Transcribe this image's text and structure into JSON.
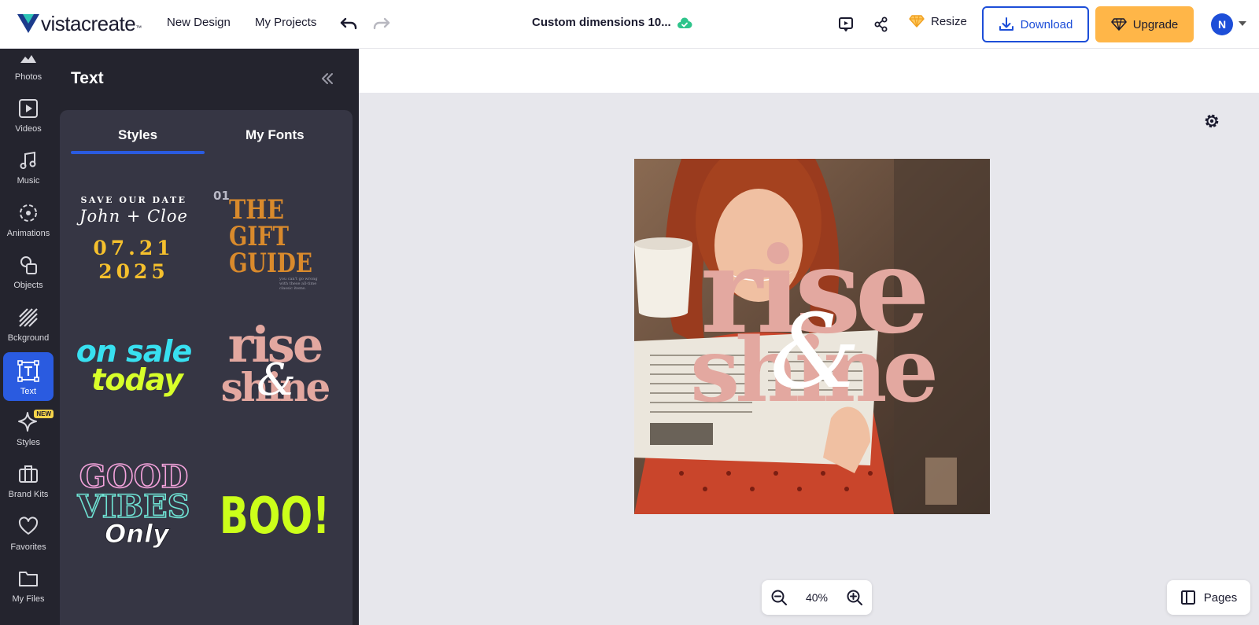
{
  "header": {
    "logo_text_a": "vista",
    "logo_text_b": "create",
    "logo_tm": "™",
    "new_design": "New Design",
    "my_projects": "My Projects",
    "doc_title": "Custom dimensions 10...",
    "resize": "Resize",
    "download": "Download",
    "upgrade": "Upgrade",
    "avatar_initial": "N"
  },
  "rail": {
    "items": [
      {
        "label": "Photos",
        "icon": "photos-icon"
      },
      {
        "label": "Videos",
        "icon": "video-icon"
      },
      {
        "label": "Music",
        "icon": "music-icon"
      },
      {
        "label": "Animations",
        "icon": "animation-icon"
      },
      {
        "label": "Objects",
        "icon": "objects-icon"
      },
      {
        "label": "Bckground",
        "icon": "background-icon"
      },
      {
        "label": "Text",
        "icon": "text-icon"
      },
      {
        "label": "Styles",
        "icon": "styles-icon"
      },
      {
        "label": "Brand Kits",
        "icon": "briefcase-icon"
      },
      {
        "label": "Favorites",
        "icon": "heart-icon"
      },
      {
        "label": "My Files",
        "icon": "folder-icon"
      }
    ],
    "new_badge": "NEW"
  },
  "panel": {
    "title": "Text",
    "tabs": [
      "Styles",
      "My Fonts"
    ],
    "tiles": {
      "t1": {
        "line1": "SAVE OUR DATE",
        "line2": "John + Cloe",
        "line3": "07.21",
        "line4": "2025"
      },
      "t2": {
        "num": "01",
        "line1": "THE",
        "line2": "GIFT",
        "line3": "GUIDE",
        "small1": "you can't go wrong",
        "small2": "with these all-time",
        "small3": "classic items."
      },
      "t3": {
        "line1": "on sale",
        "line2": "today"
      },
      "t4": {
        "line1": "rise",
        "amp": "&",
        "line2": "shine"
      },
      "t5": {
        "line1": "GOOD",
        "line2": "VIBES",
        "line3": "Only"
      },
      "t6": {
        "line1": "BOO!"
      }
    }
  },
  "canvas": {
    "art_line1": "rise",
    "art_amp": "&",
    "art_line2": "shine",
    "zoom": "40%",
    "pages": "Pages"
  },
  "colors": {
    "brand_blue": "#1d4ed8",
    "upgrade_orange": "#ffb648",
    "panel_dark": "#24242e",
    "rose_text": "#e3a8a0"
  }
}
